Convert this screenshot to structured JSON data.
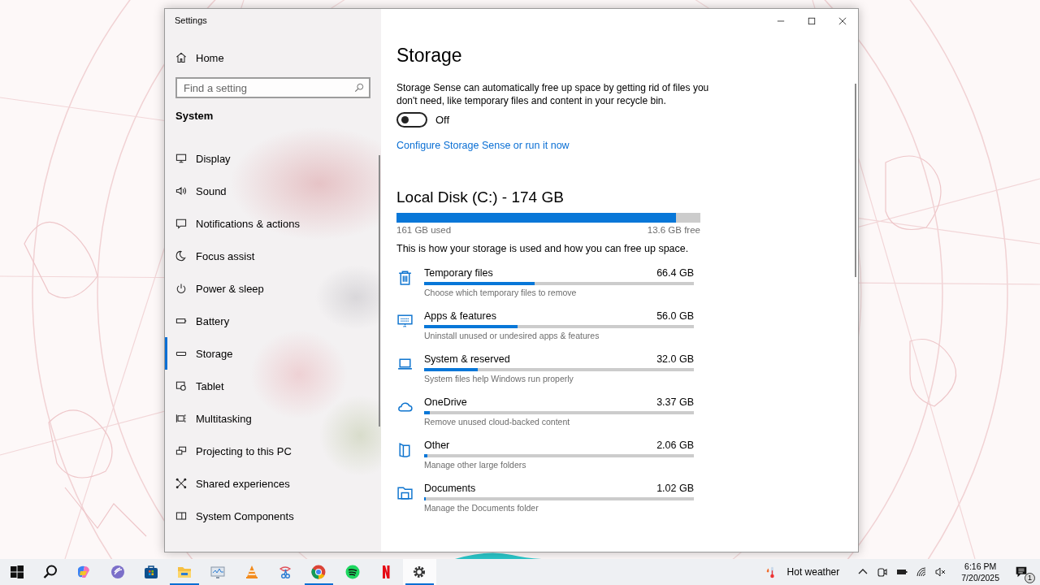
{
  "window": {
    "title": "Settings"
  },
  "sidebar": {
    "home": "Home",
    "search": {
      "placeholder": "Find a setting"
    },
    "section": "System",
    "items": [
      {
        "label": "Display",
        "kind": "monitor",
        "selected": false
      },
      {
        "label": "Sound",
        "kind": "speaker",
        "selected": false
      },
      {
        "label": "Notifications & actions",
        "kind": "speech-bubble",
        "selected": false
      },
      {
        "label": "Focus assist",
        "kind": "moon",
        "selected": false
      },
      {
        "label": "Power & sleep",
        "kind": "power",
        "selected": false
      },
      {
        "label": "Battery",
        "kind": "battery",
        "selected": false
      },
      {
        "label": "Storage",
        "kind": "drive",
        "selected": true
      },
      {
        "label": "Tablet",
        "kind": "tablet",
        "selected": false
      },
      {
        "label": "Multitasking",
        "kind": "multitask",
        "selected": false
      },
      {
        "label": "Projecting to this PC",
        "kind": "projector",
        "selected": false
      },
      {
        "label": "Shared experiences",
        "kind": "share",
        "selected": false
      },
      {
        "label": "System Components",
        "kind": "component",
        "selected": false
      }
    ]
  },
  "main": {
    "title": "Storage",
    "description": "Storage Sense can automatically free up space by getting rid of files you don't need, like temporary files and content in your recycle bin.",
    "storage_sense": {
      "on": false,
      "state_label": "Off"
    },
    "link": "Configure Storage Sense or run it now",
    "disk": {
      "title": "Local Disk (C:) - 174 GB",
      "level": 0.92,
      "used": "161 GB used",
      "free": "13.6 GB free"
    },
    "intro": "This is how your storage is used and how you can free up space.",
    "categories": [
      {
        "kind": "trash",
        "name": "Temporary files",
        "size": "66.4 GB",
        "level": 0.41,
        "hint": "Choose which temporary files to remove"
      },
      {
        "kind": "apps",
        "name": "Apps & features",
        "size": "56.0 GB",
        "level": 0.346,
        "hint": "Uninstall unused or undesired apps & features"
      },
      {
        "kind": "laptop",
        "name": "System & reserved",
        "size": "32.0 GB",
        "level": 0.2,
        "hint": "System files help Windows run properly"
      },
      {
        "kind": "cloud",
        "name": "OneDrive",
        "size": "3.37 GB",
        "level": 0.022,
        "hint": "Remove unused cloud-backed content"
      },
      {
        "kind": "folder",
        "name": "Other",
        "size": "2.06 GB",
        "level": 0.012,
        "hint": "Manage other large folders"
      },
      {
        "kind": "documents",
        "name": "Documents",
        "size": "1.02 GB",
        "level": 0.006,
        "hint": "Manage the Documents folder"
      }
    ]
  },
  "taskbar": {
    "apps": [
      {
        "kind": "start",
        "running": false,
        "selected": false
      },
      {
        "kind": "search",
        "running": false,
        "selected": false
      },
      {
        "kind": "swirl",
        "running": false,
        "selected": false
      },
      {
        "kind": "torrent",
        "running": false,
        "selected": false
      },
      {
        "kind": "store",
        "running": false,
        "selected": false
      },
      {
        "kind": "explorer",
        "running": true,
        "selected": false
      },
      {
        "kind": "monitor",
        "running": false,
        "selected": false
      },
      {
        "kind": "cone",
        "running": false,
        "selected": false
      },
      {
        "kind": "scissors",
        "running": false,
        "selected": false
      },
      {
        "kind": "browser",
        "running": true,
        "selected": false
      },
      {
        "kind": "music",
        "running": false,
        "selected": false
      },
      {
        "kind": "letter",
        "running": false,
        "selected": false
      },
      {
        "kind": "gear",
        "running": true,
        "selected": true
      }
    ],
    "weather": "Hot weather",
    "clock": {
      "time": "6:16 PM",
      "date": "7/20/2025"
    },
    "notification_count": "1"
  }
}
